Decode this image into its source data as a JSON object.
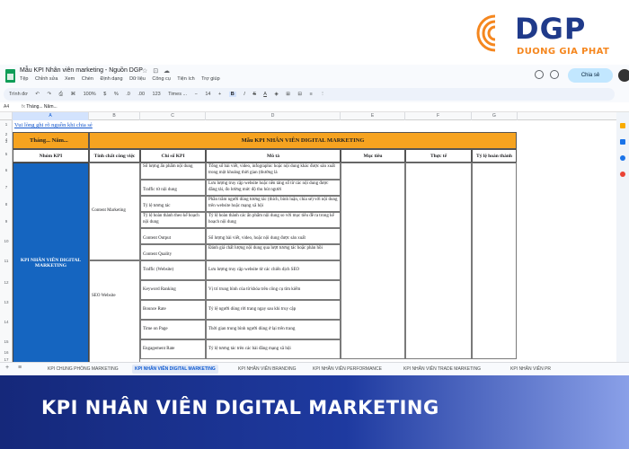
{
  "brand": {
    "name": "DGP",
    "subtitle": "DUONG GIA PHAT",
    "primary_color": "#1f3a8a",
    "accent_color": "#f5871f"
  },
  "doc": {
    "title": "Mẫu KPI Nhân viên marketing - Nguồn DGP",
    "menu": [
      "Tệp",
      "Chỉnh sửa",
      "Xem",
      "Chèn",
      "Định dạng",
      "Dữ liệu",
      "Công cụ",
      "Tiện ích",
      "Trợ giúp"
    ],
    "share_label": "Chia sẻ"
  },
  "toolbar": {
    "search": "Trình đơ",
    "zoom": "100%",
    "currency": "$",
    "percent": "%",
    "decimals_less": ".0",
    "decimals_more": ".00",
    "number_format": "123",
    "font": "Times ...",
    "font_size": "14",
    "bold": "B",
    "italic": "I",
    "strike": "S",
    "text_color": "A"
  },
  "formula": {
    "cell_ref": "A4",
    "value": "Tháng... Năm..."
  },
  "columns": [
    "A",
    "B",
    "C",
    "D",
    "E",
    "F",
    "G"
  ],
  "rows": [
    "1",
    "2",
    "3",
    "4",
    "5",
    "6",
    "7",
    "8",
    "9",
    "10",
    "11",
    "12",
    "13",
    "14",
    "15",
    "16",
    "17"
  ],
  "sheet": {
    "note": "Vui lòng ghi rõ nguồn khi chia sẻ",
    "period_label": "Tháng... Năm...",
    "main_title": "Mẫu KPI NHÂN VIÊN DIGITAL MARKETING",
    "headers": [
      "Nhóm KPI",
      "Tính chất công việc",
      "Chỉ số KPI",
      "Mô tả",
      "Mục tiêu",
      "Thực tế",
      "Tỷ lệ hoàn thành"
    ],
    "group": "KPI NHÂN VIÊN DIGITAL MARKETING",
    "category_1": "Content Marketing",
    "category_2": "SEO Website",
    "kpis": [
      {
        "name": "Số lượng ấn phẩm nội dung",
        "desc": "Tổng số bài viết, video, infographic hoặc nội dung khác được sản xuất trong một khoảng thời gian (thường là"
      },
      {
        "name": "Traffic từ nội dung",
        "desc": "Lưu lượng truy cập website hoặc nền tảng số từ các nội dung được đăng tải, đo lường mức độ thu hút người"
      },
      {
        "name": "Tỷ lệ tương tác",
        "desc": "Phần trăm người dùng tương tác (thích, bình luận, chia sẻ) với nội dung trên website hoặc mạng xã hội"
      },
      {
        "name": "Tỷ lệ hoàn thành theo kế hoạch nội dung",
        "desc": "Tỷ lệ hoàn thành các ấn phẩm nội dung so với mục tiêu đề ra trong kế hoạch nội dung"
      },
      {
        "name": "Content Output",
        "desc": "Số lượng bài viết, video, hoặc nội dung được sản xuất"
      },
      {
        "name": "Content Quality",
        "desc": "Đánh giá chất lượng nội dung qua lượt tương tác hoặc phản hồi"
      },
      {
        "name": "Traffic (Website)",
        "desc": "Lưu lượng truy cập website từ các chiến dịch SEO"
      },
      {
        "name": "Keyword Ranking",
        "desc": "Vị trí trung bình của từ khóa trên công cụ tìm kiếm"
      },
      {
        "name": "Bounce Rate",
        "desc": "Tỷ lệ người dùng rời trang ngay sau khi truy cập"
      },
      {
        "name": "Time on Page",
        "desc": "Thời gian trung bình người dùng ở lại trên trang"
      },
      {
        "name": "Engagement Rate",
        "desc": "Tỷ lệ tương tác trên các bài đăng mạng xã hội"
      }
    ]
  },
  "tabs": [
    "KPI CHUNG PHÒNG MARKETING",
    "KPI NHÂN VIÊN DIGITAL MARKETING",
    "KPI NHÂN VIÊN BRANDING",
    "KPI NHÂN VIÊN PERFORMANCE",
    "KPI NHÂN VIÊN TRADE MARKETING",
    "KPI NHÂN VIÊN PR"
  ],
  "banner": {
    "title": "KPI NHÂN VIÊN DIGITAL MARKETING"
  },
  "colors": {
    "header_orange": "#f6a320",
    "group_blue": "#1565c0",
    "banner_dark": "#15287a"
  }
}
